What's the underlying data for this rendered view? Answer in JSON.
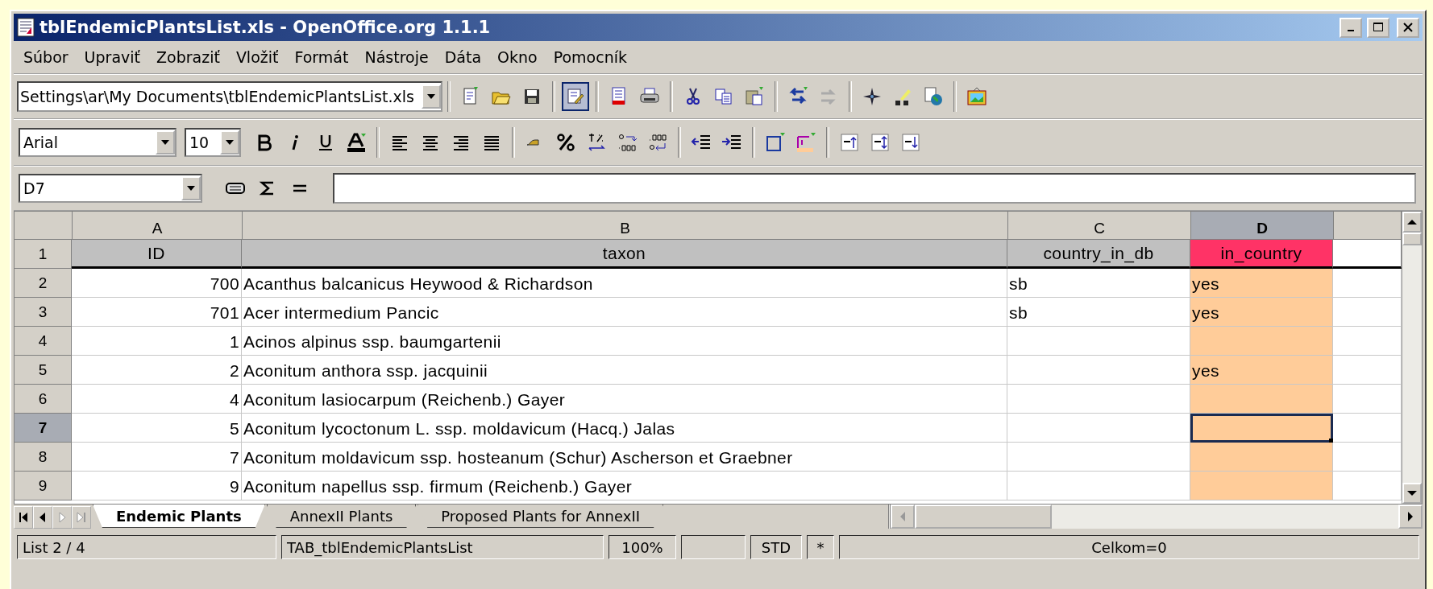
{
  "window": {
    "title": "tblEndemicPlantsList.xls - OpenOffice.org 1.1.1"
  },
  "menu": [
    "Súbor",
    "Upraviť",
    "Zobraziť",
    "Vložiť",
    "Formát",
    "Nástroje",
    "Dáta",
    "Okno",
    "Pomocník"
  ],
  "function_bar": {
    "url": "Settings\\ar\\My Documents\\tblEndemicPlantsList.xls",
    "edit_mode_on": true
  },
  "format_bar": {
    "font_name": "Arial",
    "font_size": "10"
  },
  "formula_bar": {
    "name_box": "D7"
  },
  "grid": {
    "columns": [
      {
        "label": "A",
        "kind": "number",
        "selected": false
      },
      {
        "label": "B",
        "kind": "text",
        "selected": false
      },
      {
        "label": "C",
        "kind": "text",
        "selected": false
      },
      {
        "label": "D",
        "kind": "text",
        "selected": true,
        "color": "#ffcc99"
      }
    ],
    "rows": [
      {
        "header": "1",
        "kind": "header",
        "selected": false,
        "cells": [
          "ID",
          "taxon",
          "country_in_db",
          {
            "text": "in_country",
            "color": "#ff3366"
          }
        ]
      },
      {
        "header": "2",
        "kind": "data",
        "selected": false,
        "cells": [
          "700",
          "Acanthus balcanicus Heywood & Richardson",
          "sb",
          "yes"
        ]
      },
      {
        "header": "3",
        "kind": "data",
        "selected": false,
        "cells": [
          "701",
          "Acer intermedium Pancic",
          "sb",
          "yes"
        ]
      },
      {
        "header": "4",
        "kind": "data",
        "selected": false,
        "cells": [
          "1",
          "Acinos alpinus ssp. baumgartenii",
          "",
          ""
        ]
      },
      {
        "header": "5",
        "kind": "data",
        "selected": false,
        "cells": [
          "2",
          "Aconitum anthora ssp. jacquinii",
          "",
          "yes"
        ]
      },
      {
        "header": "6",
        "kind": "data",
        "selected": false,
        "cells": [
          "4",
          "Aconitum lasiocarpum (Reichenb.) Gayer",
          "",
          ""
        ]
      },
      {
        "header": "7",
        "kind": "data",
        "selected": true,
        "cells": [
          "5",
          "Aconitum lycoctonum L. ssp. moldavicum (Hacq.) Jalas",
          "",
          ""
        ]
      },
      {
        "header": "8",
        "kind": "data",
        "selected": false,
        "cells": [
          "7",
          "Aconitum moldavicum ssp. hosteanum (Schur) Ascherson et Graebner",
          "",
          ""
        ]
      },
      {
        "header": "9",
        "kind": "data",
        "selected": false,
        "cells": [
          "9",
          "Aconitum napellus ssp. firmum (Reichenb.) Gayer",
          "",
          ""
        ]
      }
    ]
  },
  "sheet_tabs": [
    {
      "label": "Endemic Plants",
      "selected": true
    },
    {
      "label": "AnnexII Plants",
      "selected": false
    },
    {
      "label": "Proposed Plants for AnnexII",
      "selected": false
    }
  ],
  "status_bar": {
    "sheet": "List 2 / 4",
    "page_style": "TAB_tblEndemicPlantsList",
    "zoom": "100%",
    "mode": "STD",
    "modified": "*",
    "sum": "Celkom=0"
  }
}
